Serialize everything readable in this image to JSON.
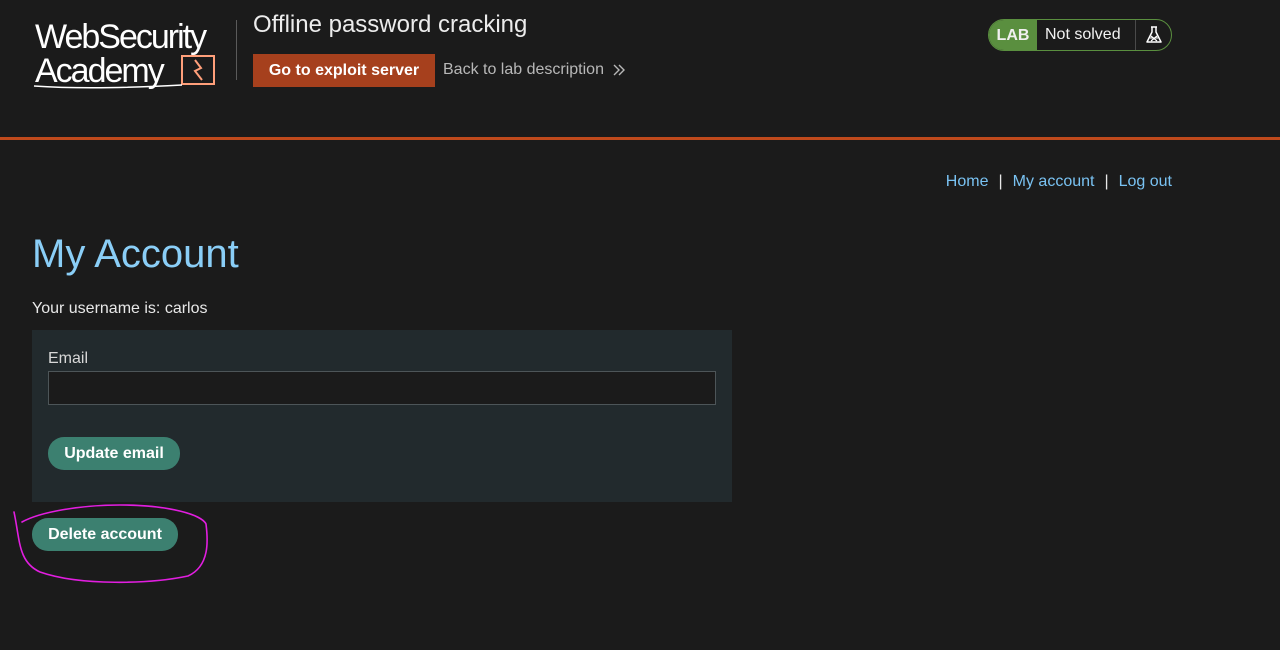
{
  "header": {
    "logo_alt": "Web Security Academy",
    "logo_line1": "WebSecurity",
    "logo_line2": "Academy",
    "lab_title": "Offline password cracking",
    "exploit_button": "Go to exploit server",
    "back_link": "Back to lab description",
    "status": {
      "badge": "LAB",
      "text": "Not solved",
      "icon": "flask-icon"
    }
  },
  "nav": {
    "home": "Home",
    "separator": "|",
    "my_account": "My account",
    "log_out": "Log out"
  },
  "main": {
    "title": "My Account",
    "username_line": "Your username is: carlos",
    "email_form": {
      "label": "Email",
      "value": "",
      "update_button": "Update email"
    },
    "delete_button": "Delete account"
  },
  "colors": {
    "background": "#1b1b1b",
    "accent_orange": "#c04a1c",
    "button_orange": "#a6401d",
    "button_green": "#3c8070",
    "status_green": "#5a8f3f",
    "link_blue": "#79c2f2",
    "title_blue": "#8acef7",
    "annotation_magenta": "#e21ee0"
  }
}
